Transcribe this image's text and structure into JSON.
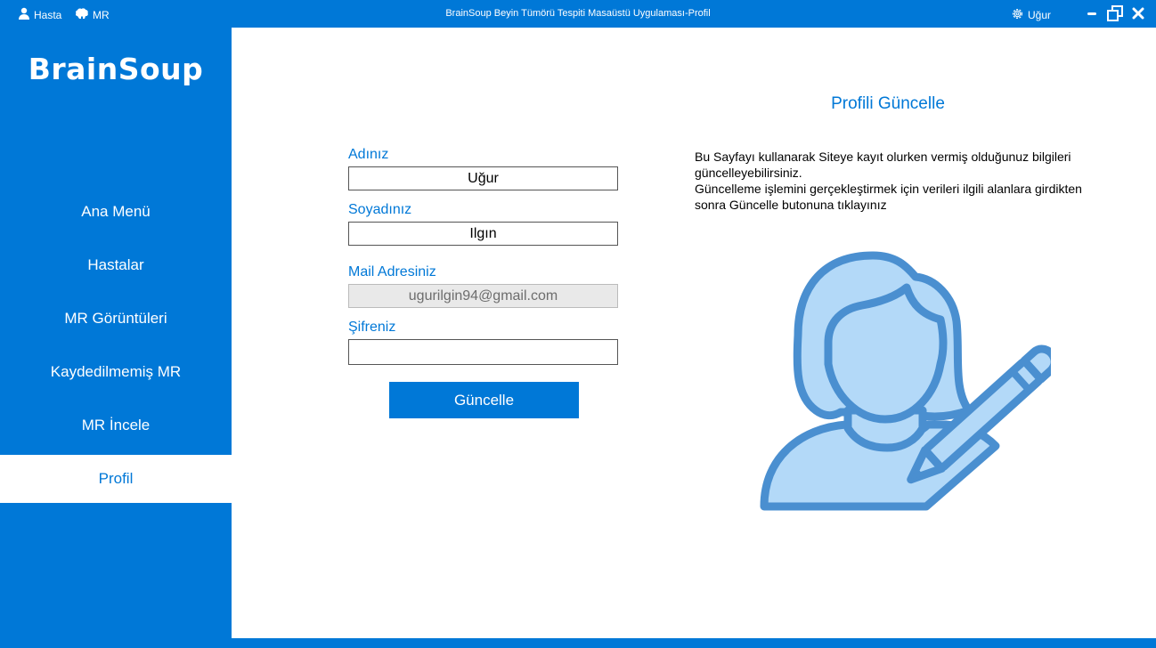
{
  "titlebar": {
    "patient_label": "Hasta",
    "mr_label": "MR",
    "title": "BrainSoup Beyin Tümörü Tespiti Masaüstü Uygulaması-Profil",
    "user_label": "Uğur"
  },
  "sidebar": {
    "brand": "BrainSoup",
    "items": [
      {
        "label": "Ana Menü"
      },
      {
        "label": "Hastalar"
      },
      {
        "label": "MR Görüntüleri"
      },
      {
        "label": "Kaydedilmemiş MR"
      },
      {
        "label": "MR İncele"
      },
      {
        "label": "Profil"
      }
    ],
    "active_item": "Profil"
  },
  "form": {
    "first_name": {
      "label": "Adınız",
      "value": "Uğur"
    },
    "last_name": {
      "label": "Soyadınız",
      "value": "Ilgın"
    },
    "email": {
      "label": "Mail Adresiniz",
      "value": "ugurilgin94@gmail.com"
    },
    "password": {
      "label": "Şifreniz",
      "value": ""
    },
    "submit_label": "Güncelle"
  },
  "info": {
    "title": "Profili Güncelle",
    "line1": "Bu Sayfayı kullanarak Siteye kayıt olurken vermiş olduğunuz bilgileri",
    "line2": "güncelleyebilirsiniz.",
    "line3": "Güncelleme işlemini gerçekleştirmek için verileri ilgili alanlara girdikten",
    "line4": "sonra  Güncelle butonuna tıklayınız"
  },
  "colors": {
    "accent": "#0078d7",
    "illustration_fill": "#b3d9f8",
    "illustration_stroke": "#4a8fd0"
  },
  "icons": {
    "patient": "user-icon",
    "mr": "brain-icon",
    "settings": "gear-icon",
    "minimize": "minimize-icon",
    "restore": "restore-icon",
    "close": "close-icon",
    "illustration": "user-edit-illustration"
  }
}
